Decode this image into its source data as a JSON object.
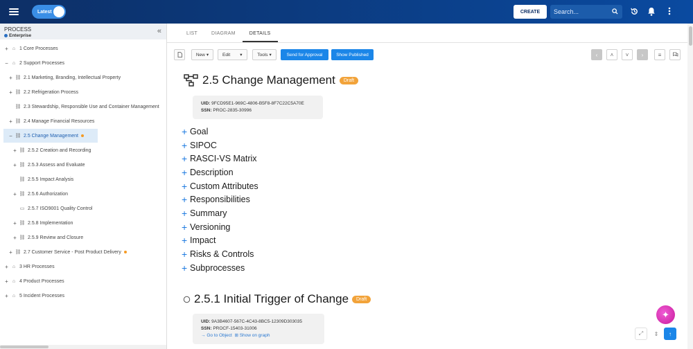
{
  "topbar": {
    "version_label": "Latest",
    "create_label": "CREATE",
    "search_placeholder": "Search..."
  },
  "sidebar": {
    "title": "PROCESS",
    "subtitle": "Enterprise",
    "items": [
      {
        "toggle": "+",
        "label": "1 Core Processes"
      },
      {
        "toggle": "−",
        "label": "2 Support Processes"
      },
      {
        "toggle": "+",
        "label": "2.1 Marketing, Branding, Intellectual Property"
      },
      {
        "toggle": "+",
        "label": "2.2 Refrigeration Process"
      },
      {
        "toggle": "",
        "label": "2.3 Stewardship, Responsible Use and Container Management"
      },
      {
        "toggle": "+",
        "label": "2.4 Manage Financial Resources"
      },
      {
        "toggle": "−",
        "label": "2.5 Change Management"
      },
      {
        "toggle": "+",
        "label": "2.5.2 Creation and Recording"
      },
      {
        "toggle": "+",
        "label": "2.5.3 Assess and Evaluate"
      },
      {
        "toggle": "",
        "label": "2.5.5 Impact Analysis"
      },
      {
        "toggle": "+",
        "label": "2.5.6 Authorization"
      },
      {
        "toggle": "",
        "label": "2.5.7 ISO9001 Quality Control"
      },
      {
        "toggle": "+",
        "label": "2.5.8 Implementation"
      },
      {
        "toggle": "+",
        "label": "2.5.9 Review and Closure"
      },
      {
        "toggle": "+",
        "label": "2.7 Customer Service - Post Product Delivery"
      },
      {
        "toggle": "+",
        "label": "3 HR Processes"
      },
      {
        "toggle": "+",
        "label": "4 Product Processes"
      },
      {
        "toggle": "+",
        "label": "5 Incident Processes"
      }
    ]
  },
  "tabs": [
    "LIST",
    "DIAGRAM",
    "DETAILS"
  ],
  "toolbar": {
    "new_label": "New",
    "edit_label": "Edit",
    "tools_label": "Tools",
    "send_label": "Send for Approval",
    "show_published_label": "Show Published"
  },
  "main_object": {
    "title": "2.5 Change Management",
    "status": "Draft",
    "uid_label": "UID:",
    "uid": "9FCD95E1-969C-4806-B5F8-8F7C22C5A70E",
    "ssn_label": "SSN:",
    "ssn": "PROC-2835-30996",
    "sections": [
      "Goal",
      "SIPOC",
      "RASCI-VS Matrix",
      "Description",
      "Custom Attributes",
      "Responsibilities",
      "Summary",
      "Versioning",
      "Impact",
      "Risks & Controls",
      "Subprocesses"
    ]
  },
  "sub_object": {
    "title": "2.5.1 Initial Trigger of Change",
    "status": "Draft",
    "uid_label": "UID:",
    "uid": "9A3B4607-567C-4C43-8BC5-12309D303035",
    "ssn_label": "SSN:",
    "ssn": "PROCF-15403-31006",
    "goto_label": "Go to Object",
    "graph_label": "Show on graph"
  },
  "colors": {
    "topbar": "#0d2f66",
    "accent": "#1b86e8",
    "draft_badge": "#f2a33a",
    "selected_bg": "#ddebf8"
  }
}
